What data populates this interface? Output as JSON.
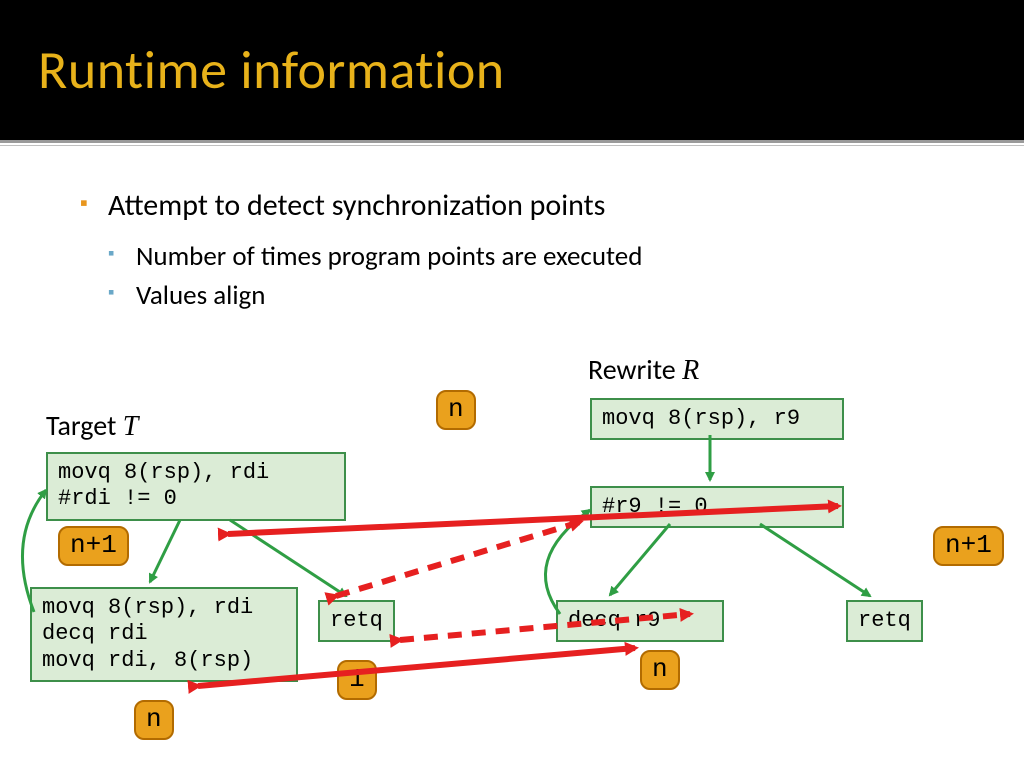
{
  "title": "Runtime information",
  "bullets": {
    "b1": "Attempt to detect synchronization points",
    "b1a": "Number of times program points are executed",
    "b1b": "Values align"
  },
  "labels": {
    "target": "Target ",
    "target_sym": "T",
    "rewrite": "Rewrite ",
    "rewrite_sym": "R"
  },
  "code": {
    "t1": "movq 8(rsp), rdi\n#rdi != 0",
    "t2": "movq 8(rsp), rdi\ndecq rdi\nmovq rdi, 8(rsp)",
    "t_ret": "retq",
    "r1": "movq 8(rsp), r9",
    "r2": "#r9 != 0",
    "r3": "decq r9",
    "r_ret": "retq"
  },
  "badges": {
    "n_top": "n",
    "t_np1": "n+1",
    "r_np1": "n+1",
    "one": "1",
    "t_n": "n",
    "r_n": "n"
  }
}
